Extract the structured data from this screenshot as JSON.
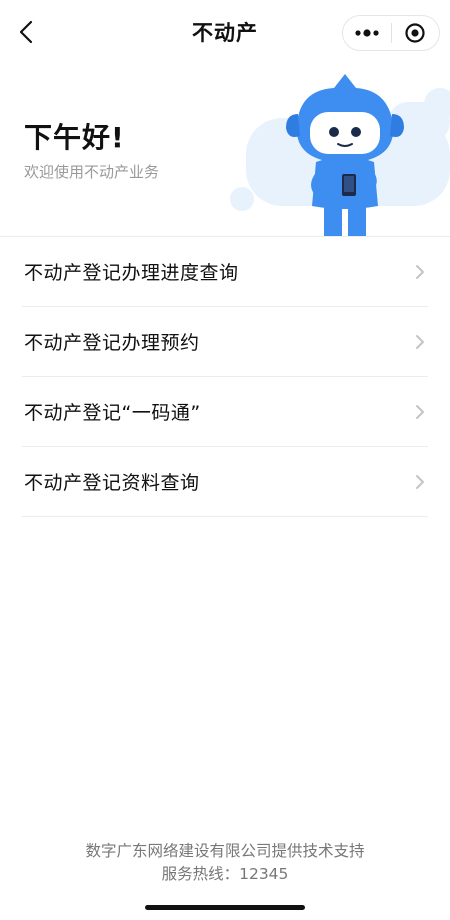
{
  "navbar": {
    "title": "不动产",
    "back_icon": "chevron-left-icon",
    "more_icon": "more-dots-icon",
    "close_icon": "target-close-icon"
  },
  "hero": {
    "greeting": "下午好!",
    "subtitle": "欢迎使用不动产业务",
    "illustration": "blue-robot-mascot-holding-phone"
  },
  "menu": {
    "items": [
      {
        "label": "不动产登记办理进度查询"
      },
      {
        "label": "不动产登记办理预约"
      },
      {
        "label": "不动产登记“一码通”"
      },
      {
        "label": "不动产登记资料查询"
      }
    ],
    "chevron_icon": "chevron-right-icon"
  },
  "footer": {
    "provider": "数字广东网络建设有限公司提供技术支持",
    "hotline": "服务热线：12345"
  },
  "colors": {
    "accent_blue": "#3d8ef0",
    "light_blue": "#e8f2fd",
    "text_primary": "#111111",
    "text_secondary": "#9a9a9a"
  }
}
